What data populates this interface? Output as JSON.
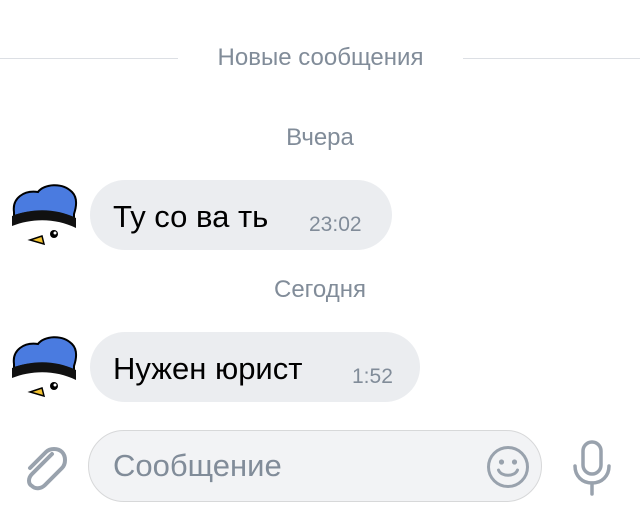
{
  "new_messages_divider": "Новые сообщения",
  "messages": [
    {
      "date": "Вчера",
      "text": "Ту со ва ть",
      "time": "23:02"
    },
    {
      "date": "Сегодня",
      "text": "Нужен юрист",
      "time": "1:52"
    }
  ],
  "composer": {
    "placeholder": "Сообщение",
    "icons": {
      "attach": "paperclip-icon",
      "emoji": "smile-icon",
      "voice": "microphone-icon"
    }
  },
  "colors": {
    "bubble_bg": "#ebedf0",
    "secondary_text": "#818c99",
    "avatar_blue": "#4a7be0",
    "icon_gray": "#99a2ad"
  }
}
